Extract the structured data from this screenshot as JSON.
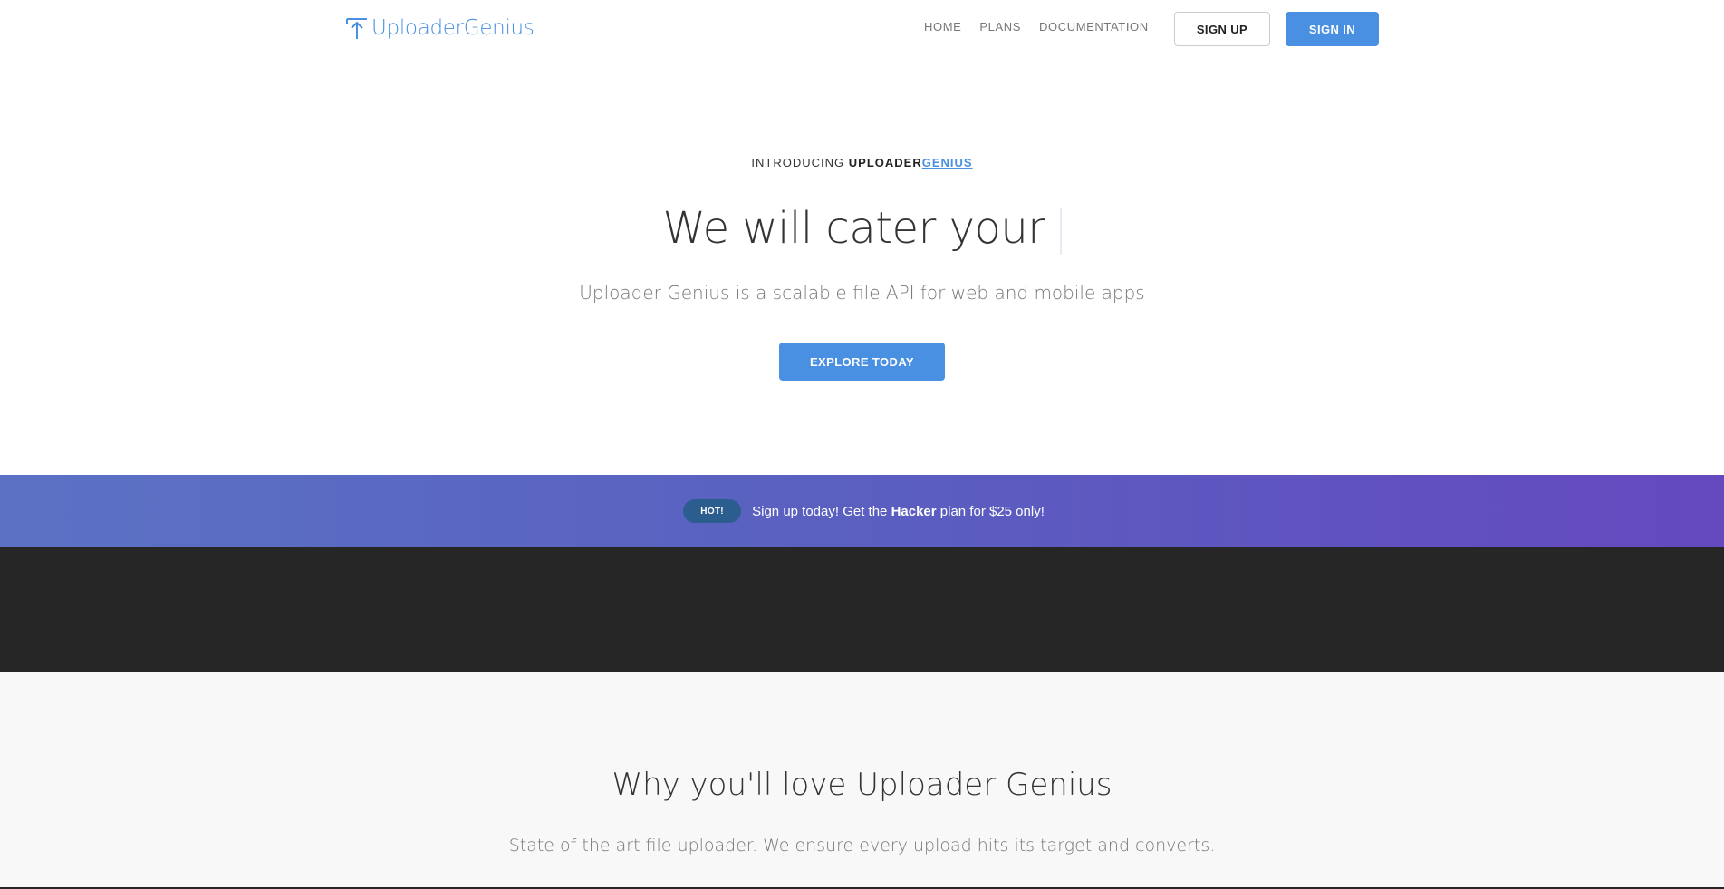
{
  "header": {
    "logo_text": "UploaderGenius",
    "nav": [
      {
        "label": "HOME"
      },
      {
        "label": "PLANS"
      },
      {
        "label": "DOCUMENTATION"
      }
    ],
    "signup_label": "SIGN UP",
    "signin_label": "SIGN IN"
  },
  "hero": {
    "intro_prefix": "INTRODUCING",
    "intro_brand_a": "UPLOADER",
    "intro_brand_b": "GENIUS",
    "title": "We will cater your",
    "subtitle": "Uploader Genius is a scalable file API for web and mobile apps",
    "cta_label": "EXPLORE TODAY"
  },
  "banner": {
    "badge": "HOT!",
    "text_before": "Sign up today! Get the ",
    "link_text": "Hacker",
    "text_after": " plan for $25 only!"
  },
  "features": {
    "title": "Why you'll love Uploader Genius",
    "subtitle": "State of the art file uploader. We ensure every upload hits its target and converts."
  },
  "colors": {
    "accent": "#4a90e2",
    "dark": "#262626",
    "banner_start": "#5b72c4",
    "banner_end": "#6549bf"
  }
}
